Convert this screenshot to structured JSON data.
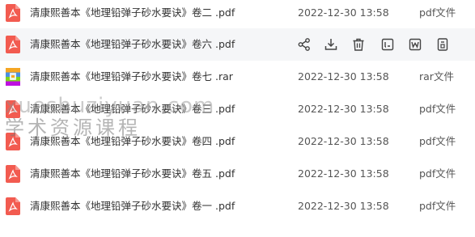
{
  "files": [
    {
      "name": "清康熙善本《地理铅弹子砂水要诀》卷二 .pdf",
      "date": "2022-12-30 13:58",
      "type": "pdf文件",
      "icon": "pdf-icon"
    },
    {
      "name": "清康熙善本《地理铅弹子砂水要诀》卷六 .pdf",
      "date": "2022-12-30 13:58",
      "type": "pdf文件",
      "icon": "pdf-icon"
    },
    {
      "name": "清康熙善本《地理铅弹子砂水要诀》卷七 .rar",
      "date": "2022-12-30 13:58",
      "type": "rar文件",
      "icon": "rar-icon"
    },
    {
      "name": "清康熙善本《地理铅弹子砂水要诀》卷三 .pdf",
      "date": "2022-12-30 13:58",
      "type": "pdf文件",
      "icon": "pdf-icon"
    },
    {
      "name": "清康熙善本《地理铅弹子砂水要诀》卷四 .pdf",
      "date": "2022-12-30 13:58",
      "type": "pdf文件",
      "icon": "pdf-icon"
    },
    {
      "name": "清康熙善本《地理铅弹子砂水要诀》卷五 .pdf",
      "date": "2022-12-30 13:58",
      "type": "pdf文件",
      "icon": "pdf-icon"
    },
    {
      "name": "清康熙善本《地理铅弹子砂水要诀》卷一 .pdf",
      "date": "2022-12-30 13:58",
      "type": "pdf文件",
      "icon": "pdf-icon"
    }
  ],
  "hover_actions": [
    "share-icon",
    "download-icon",
    "delete-icon",
    "rename-icon",
    "word-convert-icon",
    "more-icon"
  ],
  "watermark": {
    "url": "xueshuziyuan.com",
    "text": "学术资源课程"
  },
  "colors": {
    "pdf_red": "#f25b50",
    "hover_bg": "#f5f6f8",
    "text": "#333333",
    "icon": "#444444"
  }
}
